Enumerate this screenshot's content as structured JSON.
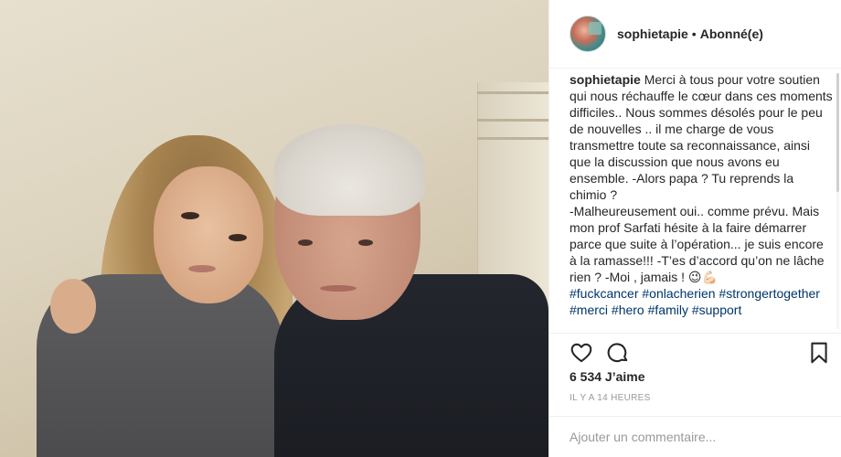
{
  "post": {
    "username": "sophietapie",
    "separator": "•",
    "follow_status": "Abonné(e)",
    "caption_lines": [
      "Merci à tous pour votre soutien qui nous réchauffe le cœur dans ces moments difficiles.. Nous sommes désolés pour le peu de nouvelles .. il me charge de vous transmettre toute sa reconnaissance, ainsi que la discussion que nous avons eu ensemble. -Alors papa ? Tu reprends la chimio ?",
      "-Malheureusement oui.. comme prévu. Mais mon prof Sarfati hésite à la faire démarrer parce que suite à l’opération... je suis encore à la ramasse!!! -T’es d’accord qu’on ne lâche rien ? -Moi , jamais ! 😉💪🏻"
    ],
    "hashtags": [
      "#fuckcancer",
      "#onlacherien",
      "#strongertogether",
      "#merci",
      "#hero",
      "#family",
      "#support"
    ],
    "likes": "6 534 J’aime",
    "timestamp": "IL Y A 14 HEURES",
    "comment_placeholder": "Ajouter un commentaire..."
  },
  "icons": {
    "like": "heart-icon",
    "comment": "comment-bubble-icon",
    "save": "bookmark-icon"
  },
  "colors": {
    "text": "#262626",
    "hashtag": "#003569",
    "muted": "#999999",
    "border": "#efefef"
  }
}
